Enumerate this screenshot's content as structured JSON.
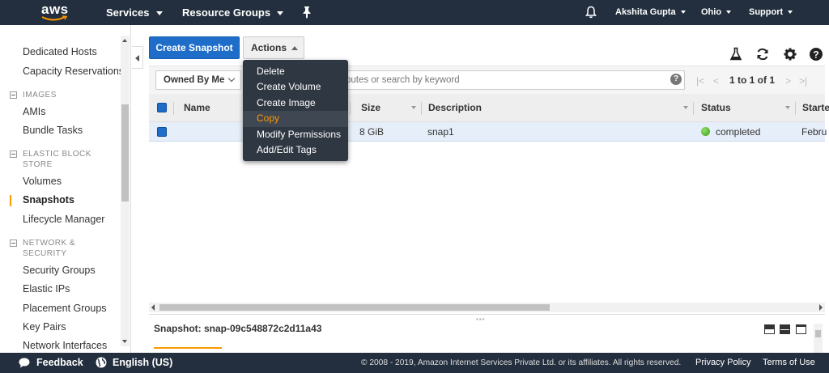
{
  "header": {
    "logo_text": "aws",
    "services_label": "Services",
    "resource_groups_label": "Resource Groups",
    "user_label": "Akshita Gupta",
    "region_label": "Ohio",
    "support_label": "Support"
  },
  "sidebar": {
    "items_top": [
      "Dedicated Hosts",
      "Capacity Reservations"
    ],
    "images_heading": "IMAGES",
    "images_items": [
      "AMIs",
      "Bundle Tasks"
    ],
    "ebs_heading_line1": "ELASTIC BLOCK",
    "ebs_heading_line2": "STORE",
    "ebs_items": [
      "Volumes",
      "Snapshots",
      "Lifecycle Manager"
    ],
    "network_heading_line1": "NETWORK &",
    "network_heading_line2": "SECURITY",
    "network_items": [
      "Security Groups",
      "Elastic IPs",
      "Placement Groups",
      "Key Pairs",
      "Network Interfaces"
    ],
    "active_item": "Snapshots"
  },
  "toolbar": {
    "create_label": "Create Snapshot",
    "actions_label": "Actions"
  },
  "actions_menu": {
    "items": [
      "Delete",
      "Create Volume",
      "Create Image",
      "Copy",
      "Modify Permissions",
      "Add/Edit Tags"
    ],
    "highlighted": "Copy"
  },
  "filter": {
    "owned_label": "Owned By Me",
    "search_placeholder": "butes or search by keyword",
    "pagination": "1 to 1 of 1"
  },
  "table": {
    "columns": [
      "Name",
      "Size",
      "Description",
      "Status",
      "Starte"
    ],
    "rows": [
      {
        "name": "",
        "size": "8 GiB",
        "description": "snap1",
        "status": "completed",
        "started": "Febru"
      }
    ]
  },
  "detail": {
    "title": "Snapshot: snap-09c548872c2d11a43"
  },
  "footer": {
    "feedback_label": "Feedback",
    "language_label": "English (US)",
    "copyright": "© 2008 - 2019, Amazon Internet Services Private Ltd. or its affiliates. All rights reserved.",
    "privacy_label": "Privacy Policy",
    "terms_label": "Terms of Use"
  },
  "colors": {
    "nav_bg": "#232f3e",
    "primary_button": "#1d6dc9",
    "accent": "#ff9900",
    "status_ok": "#3a9d15"
  }
}
